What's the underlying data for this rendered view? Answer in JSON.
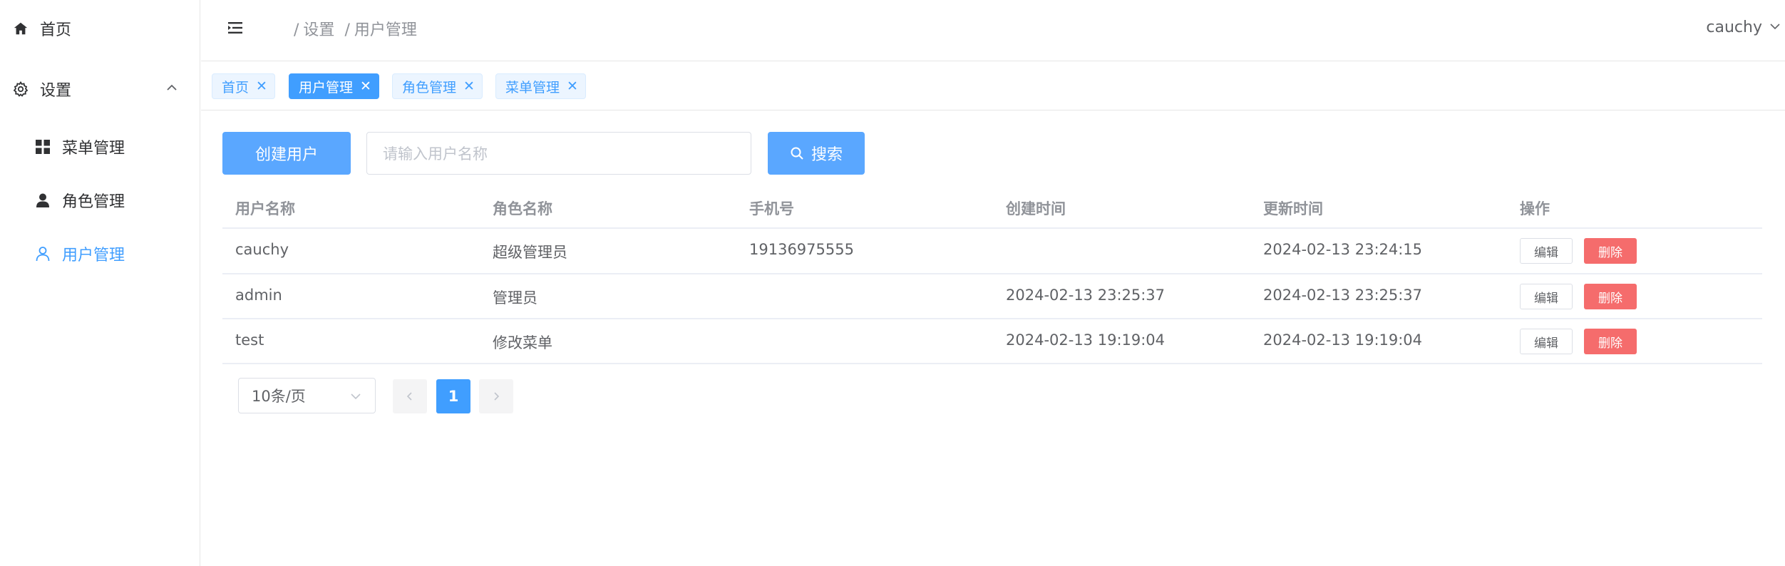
{
  "sidebar": {
    "items": [
      {
        "label": "首页",
        "icon": "home-icon"
      },
      {
        "label": "设置",
        "icon": "gear-icon"
      },
      {
        "label": "菜单管理",
        "icon": "grid-icon"
      },
      {
        "label": "角色管理",
        "icon": "user-solid-icon"
      },
      {
        "label": "用户管理",
        "icon": "user-outline-icon"
      }
    ]
  },
  "header": {
    "breadcrumb": [
      "设置",
      "用户管理"
    ],
    "breadcrumb_sep": "/",
    "username": "cauchy"
  },
  "tags": [
    {
      "label": "首页",
      "active": false
    },
    {
      "label": "用户管理",
      "active": true
    },
    {
      "label": "角色管理",
      "active": false
    },
    {
      "label": "菜单管理",
      "active": false
    }
  ],
  "toolbar": {
    "create_label": "创建用户",
    "search_placeholder": "请输入用户名称",
    "search_label": "搜索"
  },
  "table": {
    "columns": [
      "用户名称",
      "角色名称",
      "手机号",
      "创建时间",
      "更新时间",
      "操作"
    ],
    "rows": [
      {
        "username": "cauchy",
        "role": "超级管理员",
        "phone": "19136975555",
        "created": "",
        "updated": "2024-02-13 23:24:15"
      },
      {
        "username": "admin",
        "role": "管理员",
        "phone": "",
        "created": "2024-02-13 23:25:37",
        "updated": "2024-02-13 23:25:37"
      },
      {
        "username": "test",
        "role": "修改菜单",
        "phone": "",
        "created": "2024-02-13 19:19:04",
        "updated": "2024-02-13 19:19:04"
      }
    ],
    "edit_label": "编辑",
    "delete_label": "删除"
  },
  "pagination": {
    "page_size": "10条/页",
    "current_page": "1"
  },
  "colors": {
    "primary": "#409eff",
    "danger": "#f56c6c"
  }
}
